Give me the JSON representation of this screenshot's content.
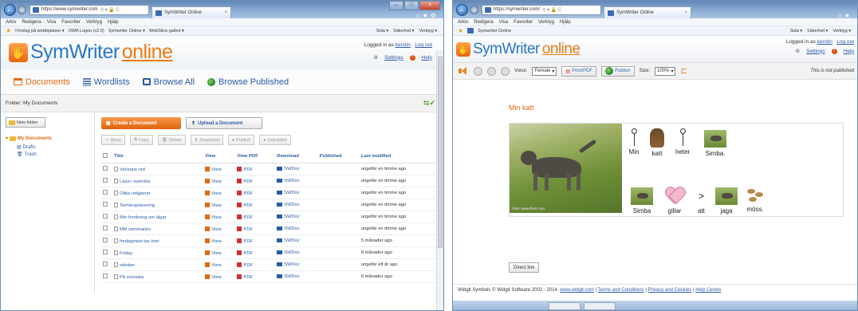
{
  "left_window": {
    "browser": {
      "address": "https://www.symwriter.com",
      "tab_title": "SymWriter Online",
      "menu": [
        "Arkiv",
        "Redigera",
        "Visa",
        "Favoriter",
        "Verktyg",
        "Hjälp"
      ],
      "favorites": [
        "Förslag på webbplatser ▾",
        "OWA Logon (v2.0)",
        "Symwriter Online ▾",
        "WebSlice-galleri ▾"
      ],
      "commands": [
        "Sida ▾",
        "Säkerhet ▾",
        "Verktyg ▾"
      ]
    },
    "app": {
      "logo_main": "SymWriter",
      "logo_sub": "online",
      "logged_in_prefix": "Logged in as",
      "user": "kerstin",
      "logout": "Log out",
      "settings": "Settings",
      "help": "Help"
    },
    "nav": {
      "documents": "Documents",
      "wordlists": "Wordlists",
      "browse_all": "Browse All",
      "browse_published": "Browse Published"
    },
    "folder_label": "Folder: My Documents",
    "new_folder": "New folder",
    "tree": {
      "root": "My Documents",
      "drafts": "Drafts",
      "trash": "Trash"
    },
    "buttons": {
      "create": "Create a Document",
      "upload": "Upload a Document",
      "move": "Move",
      "copy": "Copy",
      "delete": "Delete",
      "download": "Download",
      "publish": "Publish",
      "unpublish": "Unpublish"
    },
    "table": {
      "headers": [
        "Title",
        "View",
        "View PDF",
        "Download",
        "Published",
        "Last modified"
      ],
      "view_label": "View",
      "pdf_label": "PDF",
      "swdoc_label": "SWDoc",
      "rows": [
        {
          "title": "Veckans ord",
          "modified": "ungefär en timme ago"
        },
        {
          "title": "Läxa i svenska",
          "modified": "ungefär en timme ago"
        },
        {
          "title": "Olika religioner",
          "modified": "ungefär en timme ago"
        },
        {
          "title": "Terminsplanering",
          "modified": "ungefär en timme ago"
        },
        {
          "title": "Min forskning om älgar",
          "modified": "ungefär en timme ago"
        },
        {
          "title": "Mitt sommarlov",
          "modified": "ungefär en timme ago"
        },
        {
          "title": "fredagstest tas bort",
          "modified": "5 månader ago"
        },
        {
          "title": "Friday",
          "modified": "8 månader ago"
        },
        {
          "title": "oktober",
          "modified": "ungefär ett år ago"
        },
        {
          "title": "På svenska",
          "modified": "6 månader ago"
        }
      ]
    }
  },
  "right_window": {
    "browser": {
      "address": "https://symwriter.com/",
      "tab_title": "SymWriter Online",
      "menu": [
        "Arkiv",
        "Redigera",
        "Visa",
        "Favoriter",
        "Verktyg",
        "Hjälp"
      ],
      "favorites": [
        "Symwriter Online"
      ],
      "commands": [
        "Sida ▾",
        "Säkerhet ▾",
        "Verktyg ▾"
      ]
    },
    "app": {
      "logo_main": "SymWriter",
      "logo_sub": "online",
      "logged_in_prefix": "Logged in as",
      "user": "kerstin",
      "logout": "Log out",
      "settings": "Settings",
      "help": "Help"
    },
    "toolbar": {
      "voice_label": "Voice:",
      "voice_value": "Female",
      "print": "Print/PDF",
      "publish": "Publish",
      "size_label": "Size:",
      "size_value": "100%",
      "status": "This is not published"
    },
    "document": {
      "title": "Min katt",
      "photo_credit": "Foto: www.flickr.com",
      "line1": [
        "Min",
        "katt",
        "heter",
        "Simba."
      ],
      "line2": [
        "Simba",
        "gillar",
        "att",
        "jaga",
        "möss."
      ],
      "direct_link": "Direct link"
    },
    "footer": {
      "text": "Widgit Symbols © Widgit Software 2002 - 2014.",
      "link1": "www.widgit.com",
      "link2": "Terms and Conditions",
      "link3": "Privacy and Cookies",
      "link4": "Help Centre"
    }
  }
}
